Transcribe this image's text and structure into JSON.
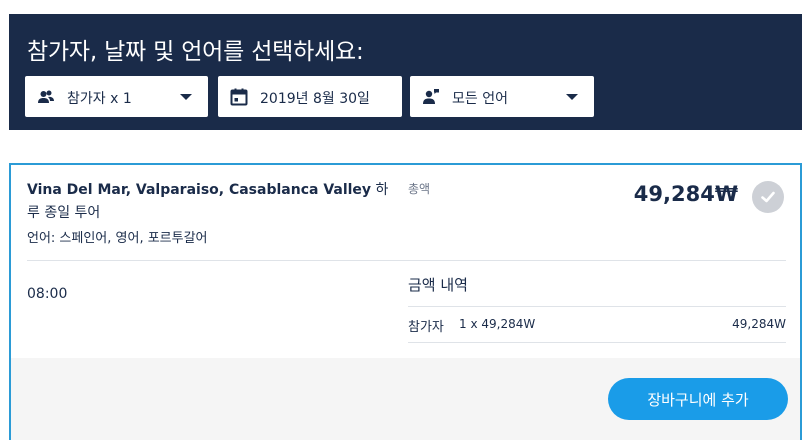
{
  "header": {
    "title": "참가자, 날짜 및 언어를 선택하세요:",
    "participants": {
      "label": "참가자 x 1",
      "icon": "people-icon"
    },
    "date": {
      "label": "2019년 8월 30일",
      "icon": "calendar-icon"
    },
    "language": {
      "label": "모든 언어",
      "icon": "language-speaker-icon"
    }
  },
  "option": {
    "title_latin": "Vina Del Mar, Valparaiso, Casablanca Valley",
    "title_korean": " 하루 종일 투어",
    "languages": "언어: 스페인어, 영어, 포르투갈어",
    "total_label": "총액",
    "total_price": "49,284₩",
    "time": "08:00",
    "breakdown_title": "금액 내역",
    "breakdown_row": {
      "label": "참가자",
      "calc": "1 x 49,284W",
      "amount": "49,284W"
    },
    "add_to_cart": "장바구니에 추가"
  },
  "colors": {
    "header_bg": "#1a2b49",
    "accent_border": "#2b9bd6",
    "button_bg": "#1a9ce8",
    "check_bg": "#cdd0d6"
  }
}
